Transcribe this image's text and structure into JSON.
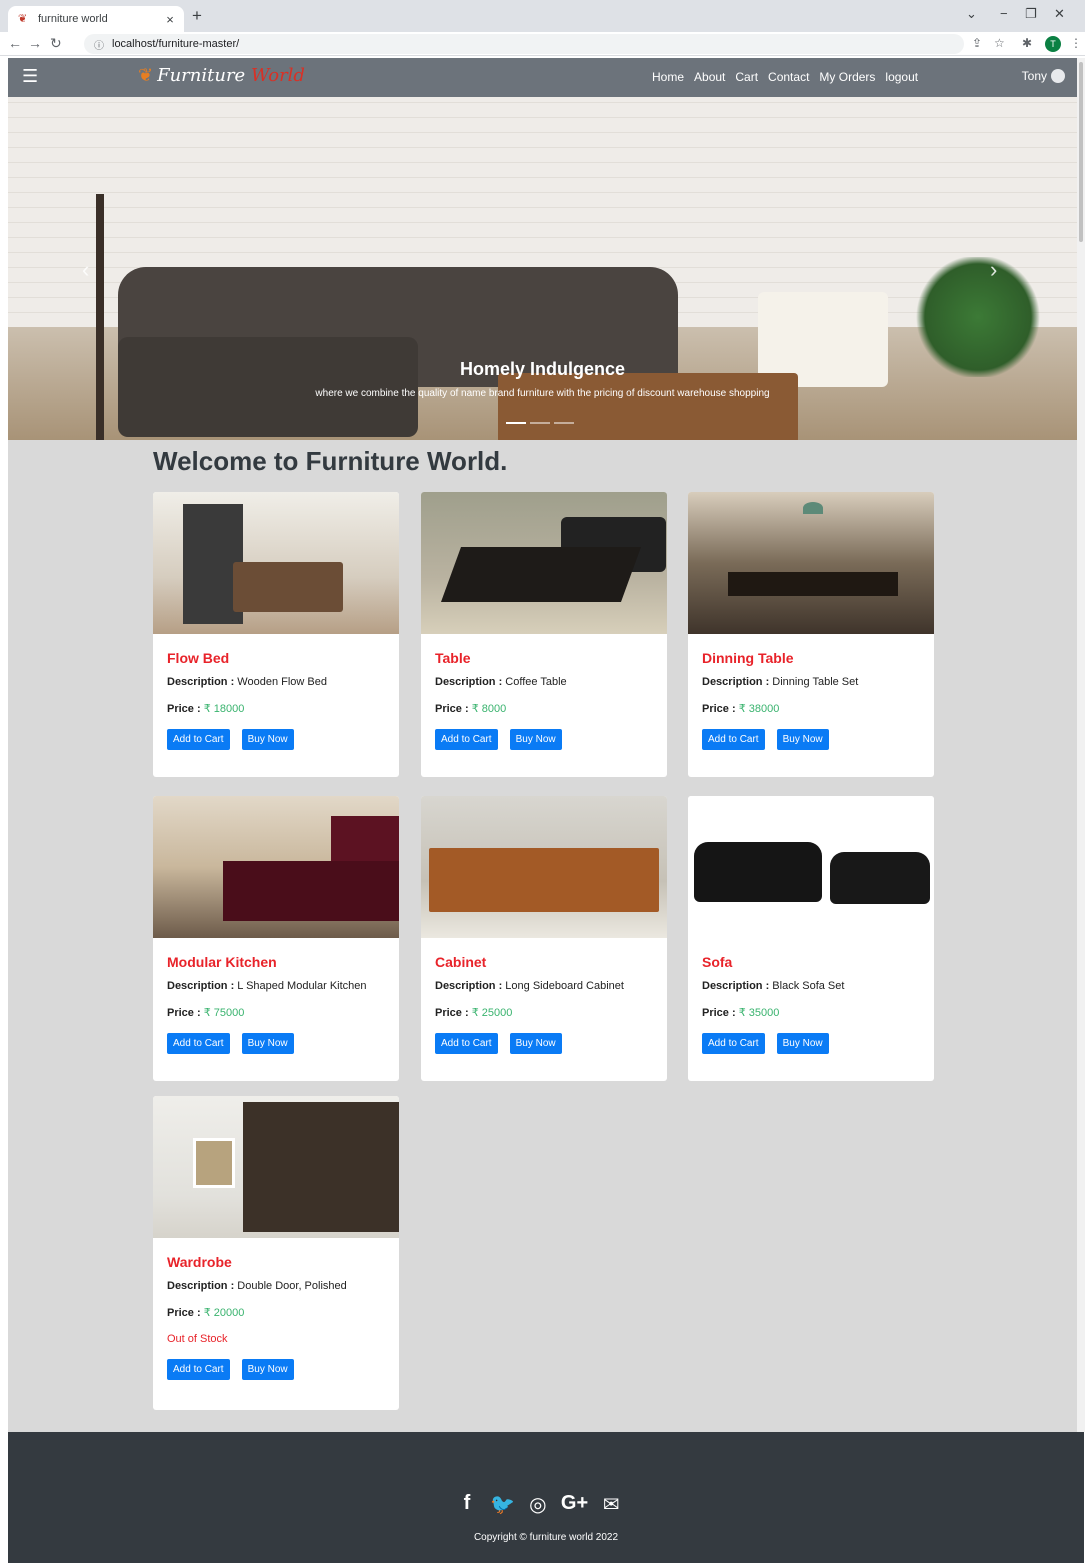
{
  "browser": {
    "tab_title": "furniture world",
    "tab_close": "×",
    "new_tab": "+",
    "url": "localhost/furniture-master/",
    "controls": {
      "minimize": "−",
      "restore": "❐",
      "close": "✕",
      "dropdown": "⌄"
    },
    "profile_initial": "T"
  },
  "navbar": {
    "brand_part1": "Furniture",
    "brand_part2": "World",
    "links": [
      "Home",
      "About",
      "Cart",
      "Contact",
      "My Orders",
      "logout"
    ],
    "user_name": "Tony"
  },
  "hero": {
    "title": "Homely Indulgence",
    "subtitle": "where we combine the quality of name brand furniture with the pricing of discount warehouse shopping",
    "prev_icon": "‹",
    "next_icon": "›"
  },
  "main": {
    "heading": "Welcome to Furniture World."
  },
  "labels": {
    "description": "Description :",
    "price": "Price :",
    "add_to_cart": "Add to Cart",
    "buy_now": "Buy Now"
  },
  "products": [
    {
      "name": "Flow Bed",
      "description": "Wooden Flow Bed",
      "price": "₹ 18000",
      "image": "bedroom-flow-bed"
    },
    {
      "name": "Table",
      "description": "Coffee Table",
      "price": "₹ 8000",
      "image": "coffee-table"
    },
    {
      "name": "Dinning Table",
      "description": "Dinning Table Set",
      "price": "₹ 38000",
      "image": "dining-room"
    },
    {
      "name": "Modular Kitchen",
      "description": "L Shaped Modular Kitchen",
      "price": "₹ 75000",
      "image": "modular-kitchen"
    },
    {
      "name": "Cabinet",
      "description": "Long Sideboard Cabinet",
      "price": "₹ 25000",
      "image": "sideboard-cabinet"
    },
    {
      "name": "Sofa",
      "description": "Black Sofa Set",
      "price": "₹ 35000",
      "image": "black-sofa-set"
    },
    {
      "name": "Wardrobe",
      "description": "Double Door, Polished",
      "price": "₹ 20000",
      "stock": "Out of Stock",
      "image": "wardrobe"
    }
  ],
  "footer": {
    "social_icons": [
      "facebook-icon",
      "twitter-icon",
      "instagram-icon",
      "google-plus-icon",
      "envelope-icon"
    ],
    "social_glyphs": [
      "f",
      "🐦",
      "◎",
      "G+",
      "✉"
    ],
    "copyright": "Copyright © furniture world 2022"
  },
  "colors": {
    "navbar": "#6c737b",
    "product_name": "#e8232a",
    "price": "#39b36e",
    "button": "#0a7bf5",
    "main_bg": "#d9d9d9",
    "footer": "#343a40"
  }
}
